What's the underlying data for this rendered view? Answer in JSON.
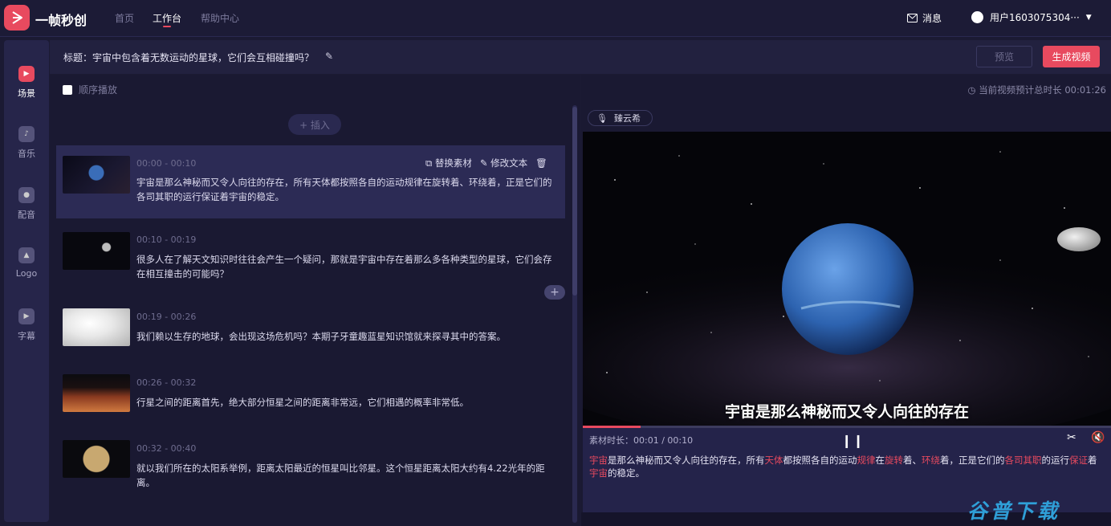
{
  "app": {
    "name": "一帧秒创"
  },
  "nav": {
    "home": "首页",
    "workspace": "工作台",
    "help": "帮助中心"
  },
  "header": {
    "messages": "消息",
    "user": "用户1603075304···"
  },
  "sidebar": {
    "items": [
      {
        "label": "场景",
        "icon": "scene-icon"
      },
      {
        "label": "音乐",
        "icon": "music-icon"
      },
      {
        "label": "配音",
        "icon": "voice-icon"
      },
      {
        "label": "Logo",
        "icon": "logo-icon"
      },
      {
        "label": "字幕",
        "icon": "subtitle-icon"
      }
    ]
  },
  "titlebar": {
    "label": "标题：宇宙中包含着无数运动的星球，它们会互相碰撞吗？",
    "preview": "预览",
    "generate": "生成视频"
  },
  "left": {
    "sequential_play": "顺序播放",
    "insert": "+ 插入",
    "replace": "替换素材",
    "edit": "修改文本"
  },
  "scenes": [
    {
      "time": "00:00 - 00:10",
      "text": "宇宙是那么神秘而又令人向往的存在，所有天体都按照各自的运动规律在旋转着、环绕着，正是它们的各司其职的运行保证着宇宙的稳定。"
    },
    {
      "time": "00:10 - 00:19",
      "text": "很多人在了解天文知识时往往会产生一个疑问，那就是宇宙中存在着那么多各种类型的星球，它们会存在相互撞击的可能吗？"
    },
    {
      "time": "00:19 - 00:26",
      "text": "我们赖以生存的地球，会出现这场危机吗？本期子牙童趣蓝星知识馆就来探寻其中的答案。"
    },
    {
      "time": "00:26 - 00:32",
      "text": "行星之间的距离首先，绝大部分恒星之间的距离非常远，它们相遇的概率非常低。"
    },
    {
      "time": "00:32 - 00:40",
      "text": "就以我们所在的太阳系举例，距离太阳最近的恒星叫比邻星。这个恒星距离太阳大约有4.22光年的距离。"
    }
  ],
  "right": {
    "total_label": "当前视频预计总时长 00:01:26",
    "voice": "臻云希",
    "subtitle": "宇宙是那么神秘而又令人向往的存在",
    "material_time": "素材时长：00:01 / 00:10",
    "progress": 0.11
  },
  "transcript": [
    {
      "t": "宇宙",
      "h": true
    },
    {
      "t": "是那么神秘而又令人向往的存在，所有",
      "h": false
    },
    {
      "t": "天体",
      "h": true
    },
    {
      "t": "都按照各自的运动",
      "h": false
    },
    {
      "t": "规律",
      "h": true
    },
    {
      "t": "在",
      "h": false
    },
    {
      "t": "旋转",
      "h": true
    },
    {
      "t": "着、",
      "h": false
    },
    {
      "t": "环绕",
      "h": true
    },
    {
      "t": "着，正是它们的",
      "h": false
    },
    {
      "t": "各司其职",
      "h": true
    },
    {
      "t": "的运行",
      "h": false
    },
    {
      "t": "保证",
      "h": true
    },
    {
      "t": "着",
      "h": false
    },
    {
      "t": "宇宙",
      "h": true
    },
    {
      "t": "的稳定。",
      "h": false
    }
  ],
  "watermark": "谷普下载",
  "colors": {
    "accent": "#e84a5f",
    "bg": "#1b1a33",
    "panel": "#22213f"
  }
}
